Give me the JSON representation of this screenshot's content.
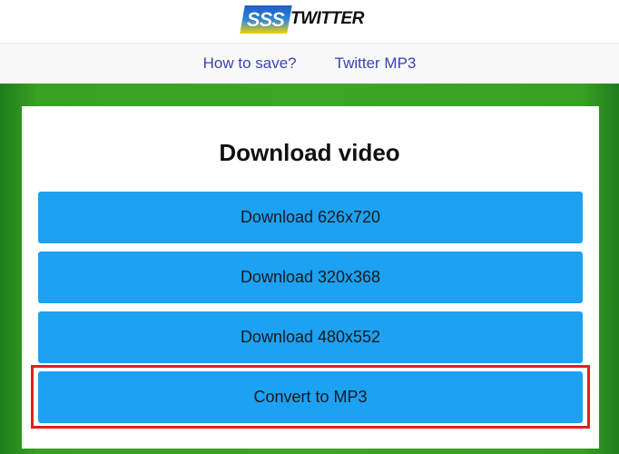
{
  "logo": {
    "badge_text": "SSS",
    "text": "TWITTER",
    "colors": {
      "badge_top": "#1f5fc6",
      "badge_bottom": "#f2d100"
    }
  },
  "nav": {
    "items": [
      {
        "label": "How to save?"
      },
      {
        "label": "Twitter MP3"
      }
    ]
  },
  "main": {
    "title": "Download video",
    "buttons": [
      {
        "label": "Download 626x720"
      },
      {
        "label": "Download 320x368"
      },
      {
        "label": "Download 480x552"
      },
      {
        "label": "Convert to MP3"
      }
    ]
  },
  "colors": {
    "button": "#1da1f2",
    "background": "#3ea626",
    "nav_link": "#3d43b0",
    "highlight": "#e0201c"
  }
}
